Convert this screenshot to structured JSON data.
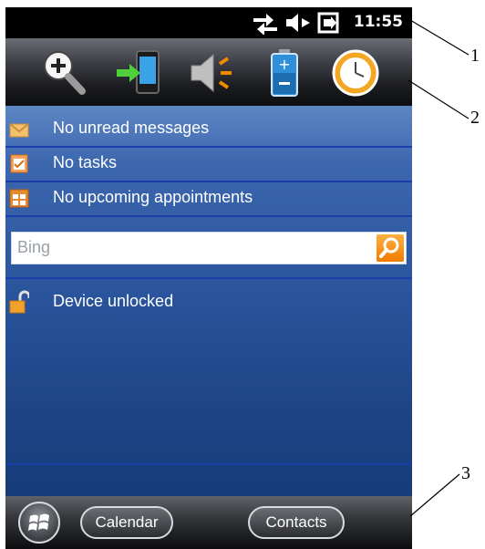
{
  "status_bar": {
    "time": "11:55",
    "icons": [
      "data-connection-icon",
      "speaker-muted-icon",
      "power-plug-icon"
    ]
  },
  "toolbar": {
    "icons": [
      "zoom-icon",
      "sync-phone-icon",
      "speaker-icon",
      "battery-icon",
      "clock-icon"
    ]
  },
  "today": {
    "messages": "No unread messages",
    "tasks": "No tasks",
    "appointments": "No upcoming appointments"
  },
  "search": {
    "placeholder": "Bing"
  },
  "lock": {
    "status": "Device unlocked"
  },
  "taskbar": {
    "left_soft_key": "Calendar",
    "right_soft_key": "Contacts"
  },
  "callouts": [
    "1",
    "2",
    "3"
  ],
  "colors": {
    "accent": "#f07c00",
    "background": "#2b569e",
    "divider": "#1a3ea8"
  }
}
